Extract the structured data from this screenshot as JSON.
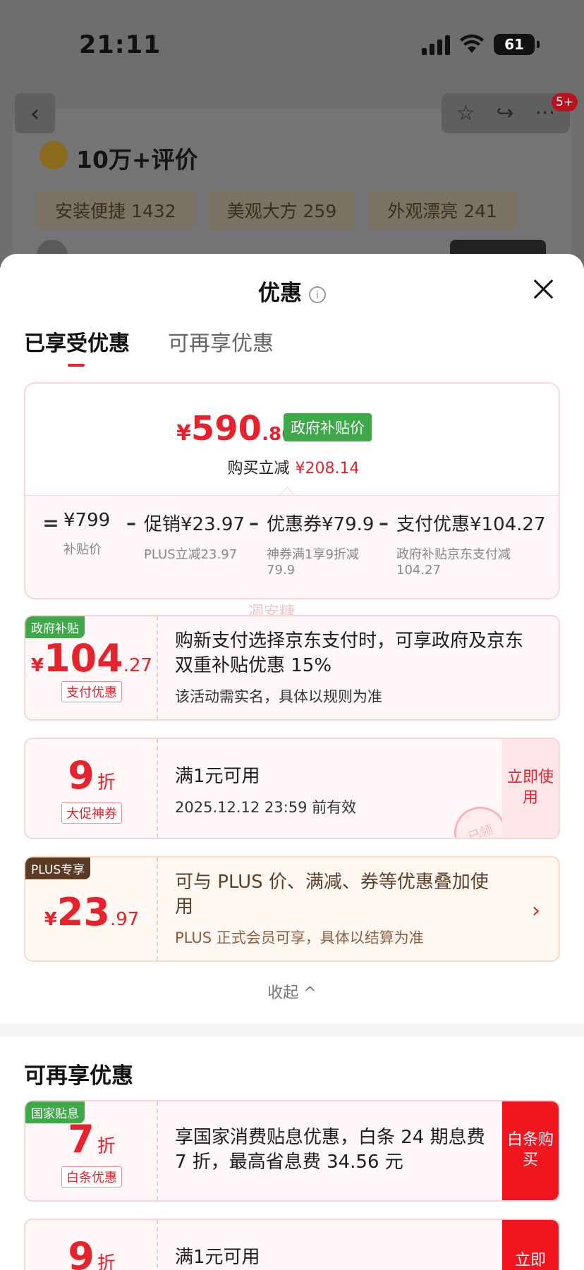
{
  "status_bar": {
    "time": "21:11",
    "battery": "61"
  },
  "background_page": {
    "notification_badge": "5+",
    "review_title": "10万+评价",
    "tags": [
      "安装便捷 1432",
      "美观大方 259",
      "外观漂亮 241"
    ]
  },
  "sheet": {
    "title": "优惠",
    "tabs": [
      {
        "label": "已享受优惠",
        "active": true
      },
      {
        "label": "可再享优惠",
        "active": false
      }
    ],
    "summary": {
      "currency": "¥",
      "price_int": "590",
      "price_dec": ".86",
      "price_badge": "政府补贴价",
      "save_label": "购买立减",
      "save_amount": "¥208.14",
      "formula": [
        {
          "op": "=",
          "main": "¥799",
          "sub": "补贴价"
        },
        {
          "op": "–",
          "main": "促销¥23.97",
          "sub": "PLUS立减23.97"
        },
        {
          "op": "–",
          "main": "优惠券¥79.9",
          "sub": "神券满1享9折减79.9"
        },
        {
          "op": "–",
          "main": "支付优惠¥104.27",
          "sub": "政府补贴京东支付减104.27"
        }
      ]
    },
    "watermark": "凋安糖",
    "cards": [
      {
        "ribbon": "政府补贴",
        "currency": "¥",
        "amount_int": "104",
        "amount_dec": ".27",
        "chip": "支付优惠",
        "line1": "购新支付选择京东支付时，可享政府及京东双重补贴优惠 15%",
        "line2": "该活动需实名，具体以规则为准"
      },
      {
        "amount_int": "9",
        "unit": "折",
        "chip": "大促神券",
        "line1": "满1元可用",
        "line2": "2025.12.12 23:59 前有效",
        "action": "立即使用",
        "stamp": "已领"
      },
      {
        "ribbon": "PLUS专享",
        "currency": "¥",
        "amount_int": "23",
        "amount_dec": ".97",
        "line1": "可与 PLUS 价、满减、券等优惠叠加使用",
        "line2": "PLUS 正式会员可享，具体以结算为准",
        "chevron": "›"
      }
    ],
    "collapse_label": "收起 ^",
    "more_section": {
      "title": "可再享优惠",
      "cards": [
        {
          "ribbon": "国家贴息",
          "amount_int": "7",
          "unit": "折",
          "chip": "白条优惠",
          "line1": "享国家消费贴息优惠，白条 24 期息费 7 折，最高省息费 34.56 元",
          "action": "白条购买"
        },
        {
          "amount_int": "9",
          "unit": "折",
          "line1": "满1元可用",
          "action": "立即"
        }
      ]
    }
  }
}
